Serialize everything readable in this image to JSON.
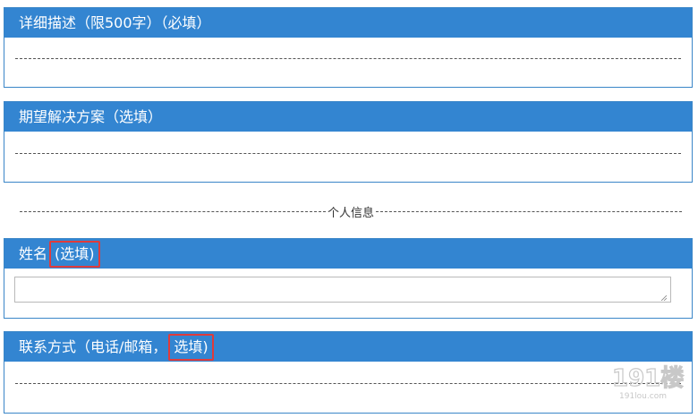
{
  "sections": {
    "description": {
      "title": "详细描述（限500字）（必填）"
    },
    "solution": {
      "title": "期望解决方案（选填）"
    },
    "personal_divider": {
      "label": "个人信息"
    },
    "name": {
      "title_prefix": "姓名",
      "title_highlight": "(选填)",
      "value": ""
    },
    "contact": {
      "title_prefix": "联系方式（电话/邮箱，",
      "title_highlight": "选填)"
    }
  },
  "watermark": {
    "text": "191楼",
    "sub": "191lou.com"
  },
  "colors": {
    "header_bg": "#3385d1",
    "highlight_border": "#e03b3b",
    "panel_border": "#3a86c8"
  }
}
